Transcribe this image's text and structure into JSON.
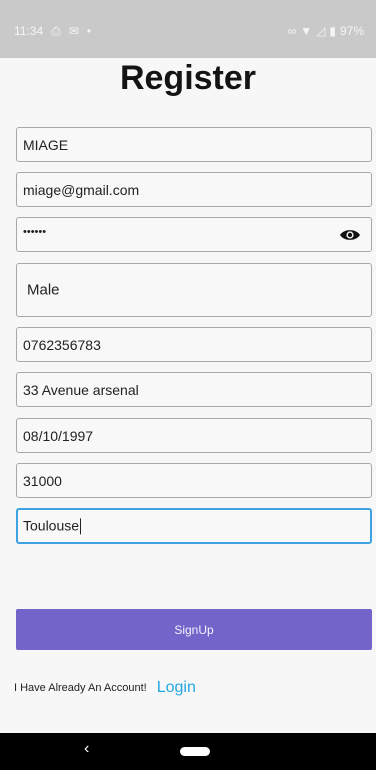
{
  "status_bar": {
    "time": "11:34",
    "icons_left": [
      "sim-icon",
      "mail-icon",
      "dot-icon"
    ],
    "icons_right": [
      "link-icon",
      "wifi-icon",
      "signal-icon",
      "battery-icon"
    ],
    "battery_percent": "97%"
  },
  "title": "Register",
  "fields": {
    "name": "MIAGE",
    "email": "miage@gmail.com",
    "password": "••••••",
    "gender": "Male",
    "phone": "0762356783",
    "address": "33 Avenue arsenal",
    "birthdate": "08/10/1997",
    "postal_code": "31000",
    "city": "Toulouse"
  },
  "signup_label": "SignUp",
  "login_prompt": "I Have Already An Account!",
  "login_link": "Login",
  "colors": {
    "accent": "#7264c9",
    "link": "#24a6e2",
    "focus": "#3ea3e3"
  }
}
